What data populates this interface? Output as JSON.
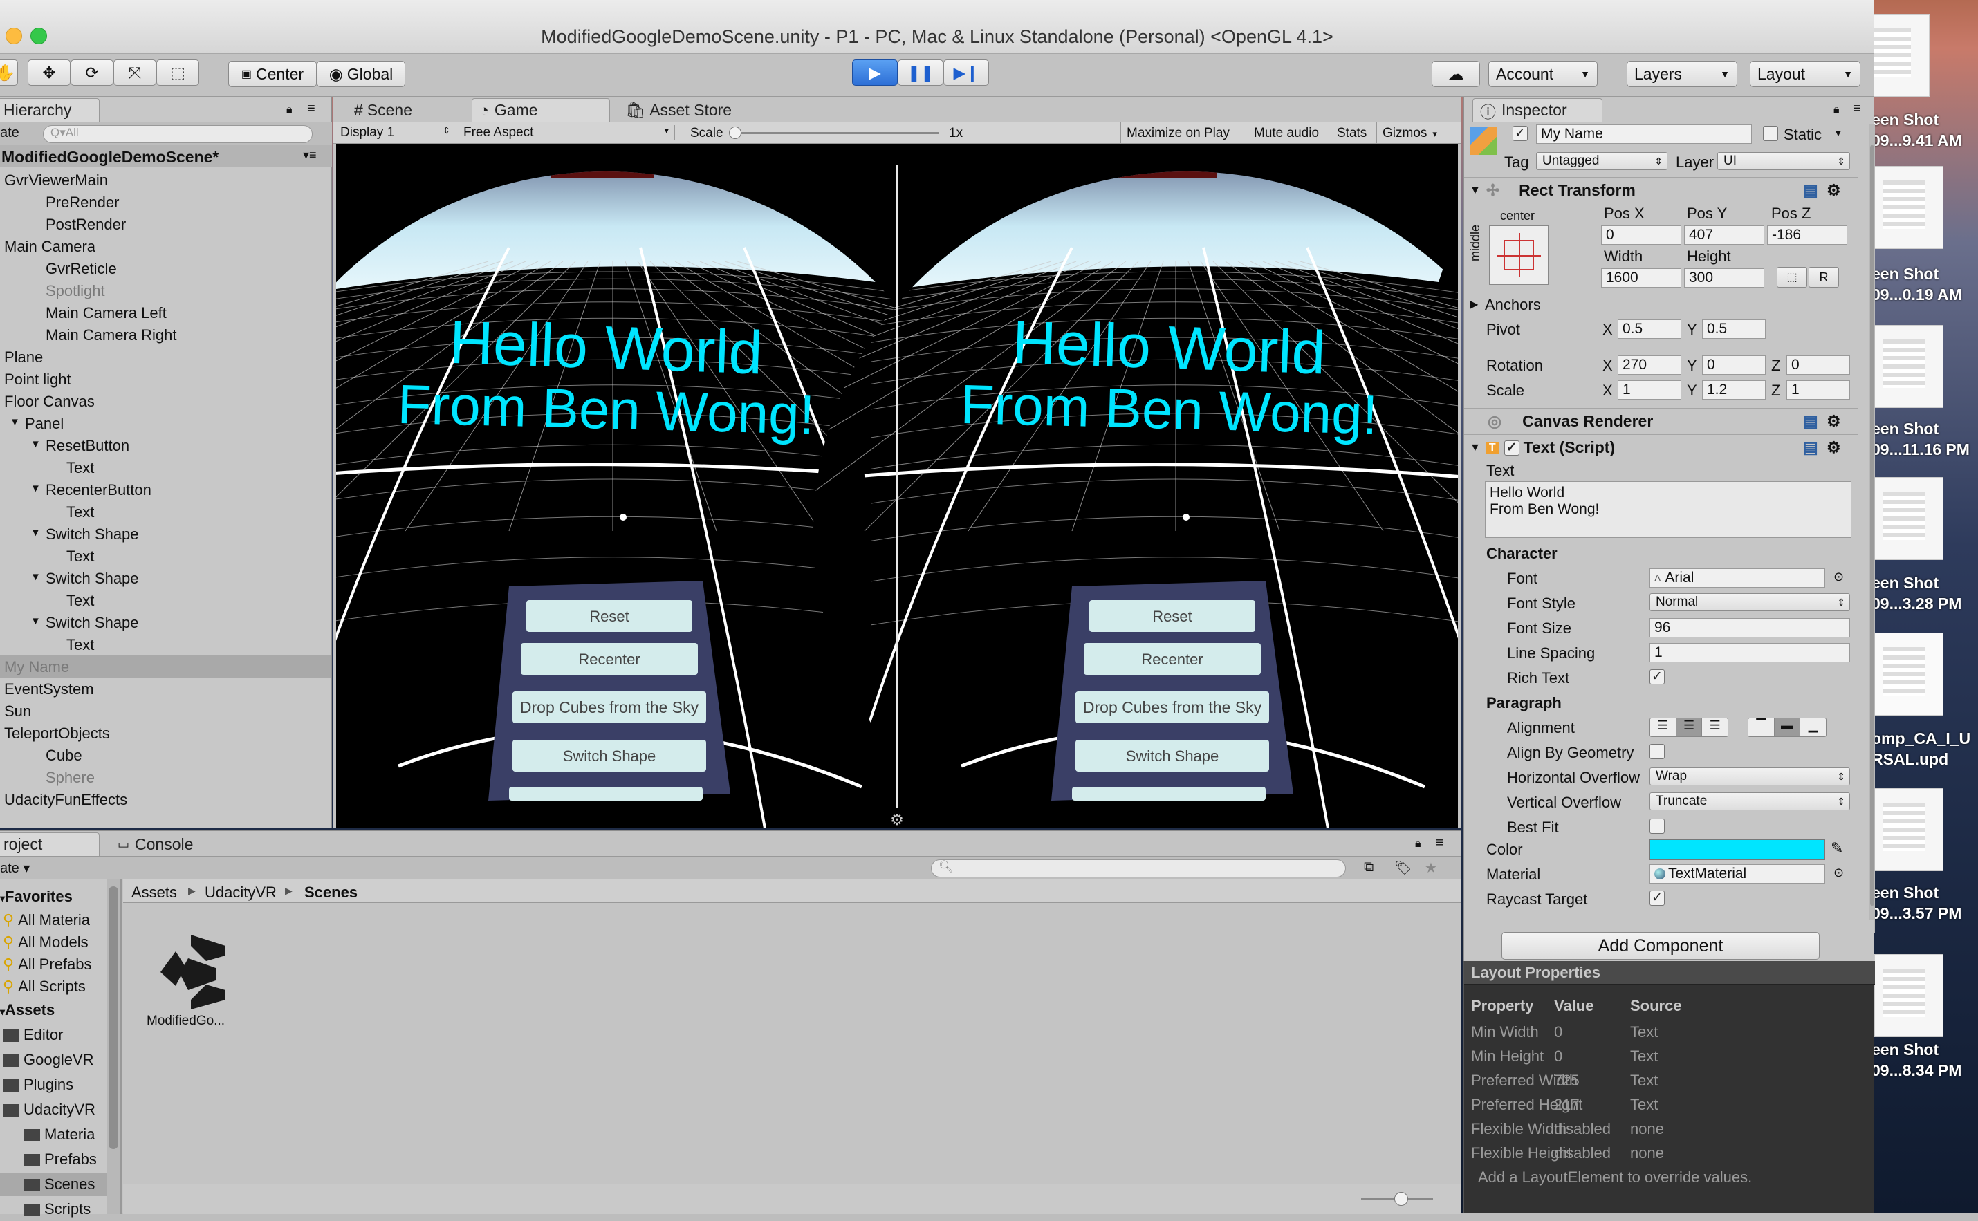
{
  "window_title": "ModifiedGoogleDemoScene.unity - P1 - PC, Mac & Linux Standalone (Personal) <OpenGL 4.1>",
  "toolbar": {
    "center": "Center",
    "global": "Global",
    "account": "Account",
    "layers": "Layers",
    "layout": "Layout"
  },
  "hierarchy": {
    "tab": "Hierarchy",
    "create": "ate",
    "search_placeholder": "Q▾All",
    "scene": "ModifiedGoogleDemoScene*",
    "items": [
      "GvrViewerMain",
      "PreRender",
      "PostRender",
      "Main Camera",
      "GvrReticle",
      "Spotlight",
      "Main Camera Left",
      "Main Camera Right",
      "Plane",
      "Point light",
      "Floor Canvas",
      "Panel",
      "ResetButton",
      "Text",
      "RecenterButton",
      "Text",
      "Switch Shape",
      "Text",
      "Switch Shape",
      "Text",
      "Switch Shape",
      "Text",
      "My Name",
      "EventSystem",
      "Sun",
      "TeleportObjects",
      "Cube",
      "Sphere",
      "UdacityFunEffects"
    ]
  },
  "game": {
    "tabs": [
      "Scene",
      "Game",
      "Asset Store"
    ],
    "display": "Display 1",
    "aspect": "Free Aspect",
    "scale_label": "Scale",
    "scale_value": "1x",
    "maximize": "Maximize on Play",
    "mute": "Mute audio",
    "stats": "Stats",
    "gizmos": "Gizmos",
    "hello_line1": "Hello World",
    "hello_line2": "From Ben Wong!",
    "menu_buttons": [
      "Reset",
      "Recenter",
      "Drop Cubes from the Sky",
      "Switch Shape"
    ]
  },
  "project": {
    "tabs": [
      "roject",
      "Console"
    ],
    "create": "ate",
    "breadcrumb": [
      "Assets",
      "UdacityVR",
      "Scenes"
    ],
    "favorites_header": "Favorites",
    "favorites": [
      "All Materia",
      "All Models",
      "All Prefabs",
      "All Scripts"
    ],
    "assets_header": "Assets",
    "folders": [
      "Editor",
      "GoogleVR",
      "Plugins",
      "UdacityVR",
      "Materia",
      "Prefabs",
      "Scenes",
      "Scripts"
    ],
    "asset_name": "ModifiedGo..."
  },
  "inspector": {
    "tab": "Inspector",
    "object_name": "My Name",
    "static": "Static",
    "tag_label": "Tag",
    "tag_value": "Untagged",
    "layer_label": "Layer",
    "layer_value": "UI",
    "rect_transform": "Rect Transform",
    "anchor_h": "center",
    "anchor_v": "middle",
    "posx_label": "Pos X",
    "posy_label": "Pos Y",
    "posz_label": "Pos Z",
    "posx": "0",
    "posy": "407",
    "posz": "-186",
    "width_label": "Width",
    "height_label": "Height",
    "width": "1600",
    "height": "300",
    "anchors": "Anchors",
    "pivot": "Pivot",
    "pivot_x": "0.5",
    "pivot_y": "0.5",
    "rotation": "Rotation",
    "rot_x": "270",
    "rot_y": "0",
    "rot_z": "0",
    "scale": "Scale",
    "scale_x": "1",
    "scale_y": "1.2",
    "scale_z": "1",
    "canvas_renderer": "Canvas Renderer",
    "text_script": "Text (Script)",
    "text_label": "Text",
    "text_value_1": "Hello World",
    "text_value_2": "From Ben Wong!",
    "character": "Character",
    "font": "Font",
    "font_value": "Arial",
    "font_style": "Font Style",
    "font_style_value": "Normal",
    "font_size": "Font Size",
    "font_size_value": "96",
    "line_spacing": "Line Spacing",
    "line_spacing_value": "1",
    "rich_text": "Rich Text",
    "paragraph": "Paragraph",
    "alignment": "Alignment",
    "align_by_geometry": "Align By Geometry",
    "horizontal_overflow": "Horizontal Overflow",
    "horizontal_overflow_value": "Wrap",
    "vertical_overflow": "Vertical Overflow",
    "vertical_overflow_value": "Truncate",
    "best_fit": "Best Fit",
    "color": "Color",
    "material": "Material",
    "material_value": "TextMaterial",
    "raycast_target": "Raycast Target",
    "add_component": "Add Component",
    "layout_properties": "Layout Properties",
    "lp_headers": [
      "Property",
      "Value",
      "Source"
    ],
    "lp_rows": [
      [
        "Min Width",
        "0",
        "Text"
      ],
      [
        "Min Height",
        "0",
        "Text"
      ],
      [
        "Preferred Width",
        "725",
        "Text"
      ],
      [
        "Preferred Height",
        "217",
        "Text"
      ],
      [
        "Flexible Width",
        "disabled",
        "none"
      ],
      [
        "Flexible Height",
        "disabled",
        "none"
      ]
    ],
    "lp_footer": "Add a LayoutElement to override values.",
    "text_color": "#00e5ff"
  },
  "desktop": {
    "labels": [
      "een Shot",
      "09...9.41 AM",
      "een Shot",
      "09...0.19 AM",
      "een Shot",
      "09...11.16 PM",
      "een Shot",
      "09...3.28 PM",
      "omp_CA_I_U",
      "RSAL.upd",
      "een Shot",
      "09...3.57 PM",
      "een Shot",
      "09...8.34 PM"
    ]
  }
}
